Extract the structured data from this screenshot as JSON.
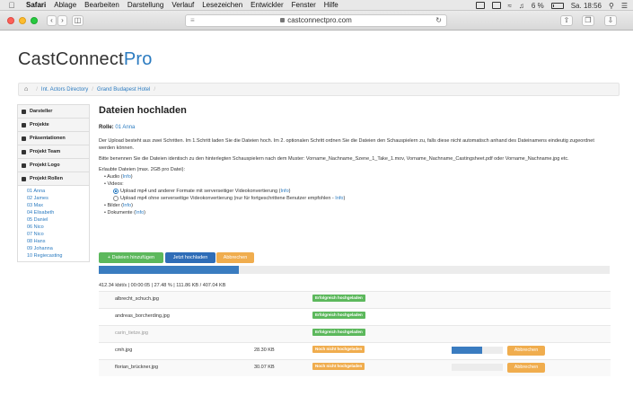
{
  "menubar": {
    "items": [
      "Safari",
      "Ablage",
      "Bearbeiten",
      "Darstellung",
      "Verlauf",
      "Lesezeichen",
      "Entwickler",
      "Fenster",
      "Hilfe"
    ],
    "battery": "6 %",
    "clock": "Sa. 18:56"
  },
  "browser": {
    "url": "castconnectpro.com"
  },
  "logo": {
    "main": "CastConnect",
    "accent": "Pro"
  },
  "breadcrumb": [
    "Int. Actors Directory",
    "Grand Budapest Hotel"
  ],
  "sidebar": {
    "items": [
      "Darsteller",
      "Projekte",
      "Präsentationen",
      "Projekt Team",
      "Projekt Logo",
      "Projekt Rollen"
    ],
    "roles": [
      "01 Anna",
      "02 James",
      "03 Max",
      "04 Elisabeth",
      "05 Daniel",
      "06 Nico",
      "07 Nico",
      "08 Hans",
      "09 Johanna",
      "10 Regiecasting"
    ]
  },
  "main": {
    "title": "Dateien hochladen",
    "role_label": "Rolle:",
    "role_value": "01 Anna",
    "intro": "Der Upload besteht aus zwei Schritten. Im 1.Schritt laden Sie die Dateien hoch. Im 2. optionalen Schritt ordnen Sie die Dateien den Schauspielern zu, falls diese nicht automatisch anhand des Dateinamens eindeutig zugeordnet werden können.",
    "naming": "Bitte benennen Sie die Dateien identisch zu den hinterlegten Schauspielern nach dem Muster: Vorname_Nachname_Szene_1_Take_1.mov, Vorname_Nachname_Castingsheet.pdf oder Vorname_Nachname.jpg etc.",
    "allowed": "Erlaubte Dateien (max. 2GB pro Datei):",
    "audio": "Audio",
    "videos": "Videos:",
    "video_opt1": "Upload mp4 und anderer Formate mit serverseitiger Videokonvertierung",
    "video_opt2": "Upload mp4 ohne serverseitige Videokonvertierung (nur für fortgeschrittene Benutzer empfohlen -",
    "images": "Bilder",
    "documents": "Dokumente",
    "info": "Info",
    "info_paren_open": "(",
    "info_paren_close": ")",
    "info_dash_close": ")"
  },
  "buttons": {
    "add_files": "Dateien hinzufügen",
    "upload_now": "Jetzt hochladen",
    "cancel": "Abbrechen"
  },
  "upload": {
    "progress_fraction": 0.2748,
    "stats": "412.34 kbit/s | 00:00:05 | 27.48 % | 111.86 KB / 407.04 KB"
  },
  "files": [
    {
      "name": "albrecht_schuch.jpg",
      "size": "",
      "status": "Erfolgreich hochgeladen",
      "state": "ok",
      "progress": null
    },
    {
      "name": "andreas_borcherding.jpg",
      "size": "",
      "status": "Erfolgreich hochgeladen",
      "state": "ok",
      "progress": null
    },
    {
      "name": "carin_tietze.jpg",
      "size": "",
      "status": "Erfolgreich hochgeladen",
      "state": "ok",
      "progress": null
    },
    {
      "name": "cmh.jpg",
      "size": "28.30 KB",
      "status": "Noch nicht hochgeladen",
      "state": "no",
      "progress": 0.6
    },
    {
      "name": "florian_brückner.jpg",
      "size": "30.07 KB",
      "status": "Noch nicht hochgeladen",
      "state": "no",
      "progress": 0
    }
  ],
  "colors": {
    "link": "#2b7bc0",
    "success": "#5cb85c",
    "warning": "#f0ad4e",
    "primary": "#2f6db7"
  }
}
